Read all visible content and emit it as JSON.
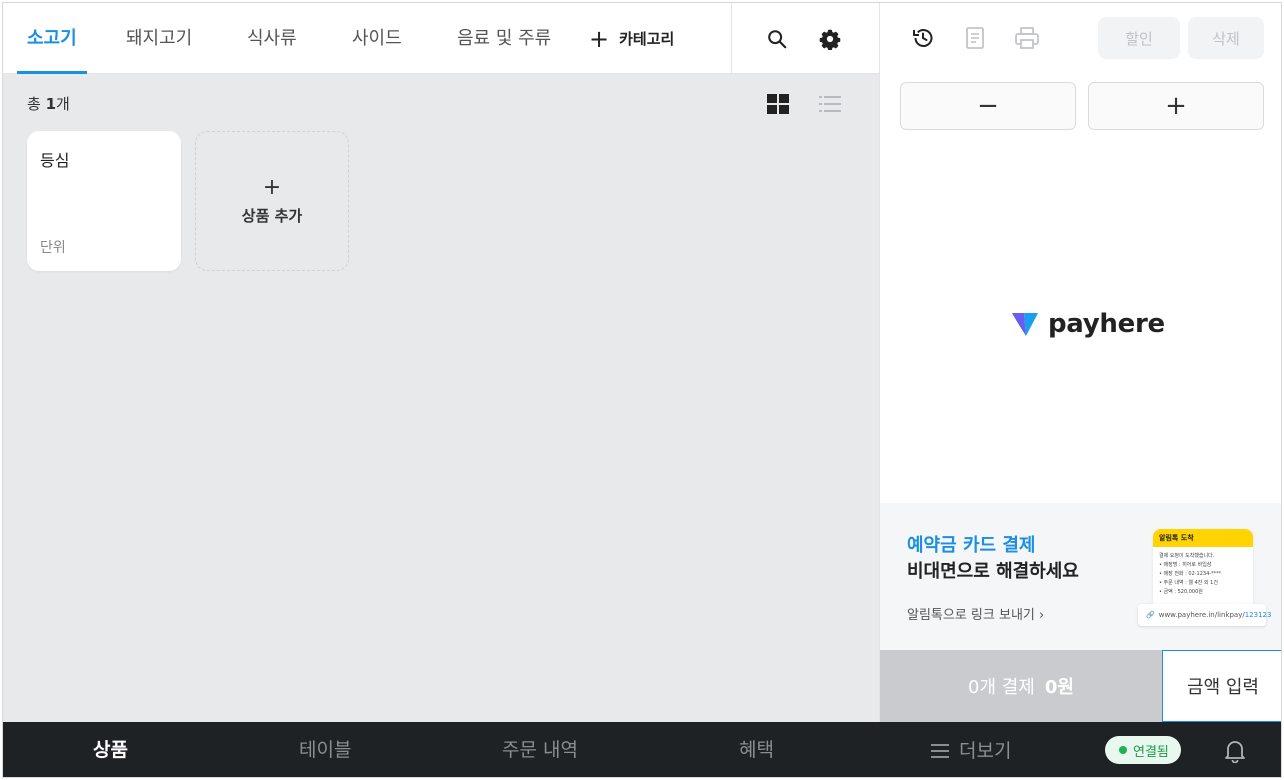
{
  "categories": {
    "tabs": [
      {
        "label": "소고기",
        "active": true
      },
      {
        "label": "돼지고기",
        "active": false
      },
      {
        "label": "식사류",
        "active": false
      },
      {
        "label": "사이드",
        "active": false
      },
      {
        "label": "음료 및 주류",
        "active": false
      }
    ],
    "add_category_label": "카테고리"
  },
  "products": {
    "count_prefix": "총",
    "count_value": "1",
    "count_suffix": "개",
    "items": [
      {
        "name": "등심",
        "unit": "단위"
      }
    ],
    "add_product_label": "상품 추가"
  },
  "order_panel": {
    "discount_label": "할인",
    "delete_label": "삭제",
    "minus_label": "−",
    "plus_label": "+",
    "logo_text": "payhere"
  },
  "promo": {
    "title_accent": "예약금 카드 결제",
    "title_main": "비대면으로 해결하세요",
    "link_label": "알림톡으로 링크 보내기",
    "phone_header": "알림톡 도착",
    "phone_lines": [
      "결제 요청이 도착했습니다.",
      "• 매장명 : 히어로 바입삼",
      "• 매장 전화 : 02-1234-****",
      "• 주문 내역 : 웰 4잔 외 1건",
      "• 금액 : 520,000원"
    ],
    "url_prefix": "www.payhere.in/linkpay/",
    "url_highlight": "123123"
  },
  "payment": {
    "count_label": "0개 결제",
    "amount_label": "0원",
    "amount_input_label": "금액 입력"
  },
  "bottom_nav": {
    "items": [
      {
        "label": "상품",
        "active": true
      },
      {
        "label": "테이블",
        "active": false
      },
      {
        "label": "주문 내역",
        "active": false
      },
      {
        "label": "혜택",
        "active": false
      },
      {
        "label": "더보기",
        "active": false
      }
    ],
    "status_label": "연결됨"
  },
  "colors": {
    "accent": "#1a8fe3",
    "dark_nav": "#1f2225",
    "connected": "#1fb155",
    "promo_phone": "#ffd400"
  }
}
